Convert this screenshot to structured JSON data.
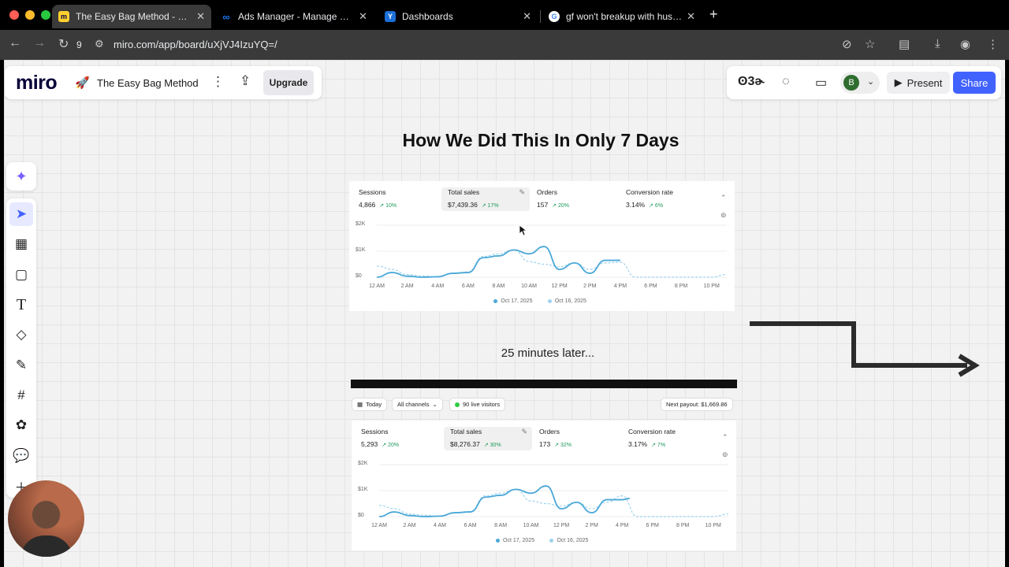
{
  "browser": {
    "tabs": [
      {
        "title": "The Easy Bag Method - Miro",
        "active": true,
        "favicon": "miro-icon"
      },
      {
        "title": "Ads Manager - Manage ads -",
        "active": false,
        "favicon": "meta-icon"
      },
      {
        "title": "Dashboards",
        "active": false,
        "favicon": "dashboards-icon"
      },
      {
        "title": "gf won't breakup with husban",
        "active": false,
        "favicon": "google-icon"
      }
    ],
    "history_count": "9",
    "url": "miro.com/app/board/uXjVJ4IzuYQ=/"
  },
  "miro": {
    "logo": "miro",
    "board_name": "The Easy Bag Method",
    "upgrade_label": "Upgrade",
    "reactions_label": "ʘ3ɚ",
    "avatar_initial": "B",
    "present_label": "Present",
    "share_label": "Share",
    "tools": [
      "select-tool",
      "templates-tool",
      "sticky-note-tool",
      "text-tool",
      "shapes-tool",
      "pen-tool",
      "frame-tool",
      "apps-tool",
      "comment-tool",
      "more-tool"
    ]
  },
  "board": {
    "heading": "How We Did This In Only 7 Days",
    "caption": "25 minutes later...",
    "colors": {
      "series_today": "#4aa8d8",
      "series_prev": "#9fd3ee",
      "positive": "#1d9a5a",
      "accent": "#4262ff"
    }
  },
  "dashboard_before": {
    "metrics": [
      {
        "label": "Sessions",
        "value": "4,866",
        "delta": "↗ 10%"
      },
      {
        "label": "Total sales",
        "value": "$7,439.36",
        "delta": "↗ 17%"
      },
      {
        "label": "Orders",
        "value": "157",
        "delta": "↗ 20%"
      },
      {
        "label": "Conversion rate",
        "value": "3.14%",
        "delta": "↗ 6%"
      }
    ]
  },
  "dashboard_after": {
    "toolbar": {
      "date": "Today",
      "channels": "All channels",
      "live": "90 live visitors",
      "payout": "Next payout: $1,669.86"
    },
    "metrics": [
      {
        "label": "Sessions",
        "value": "5,293",
        "delta": "↗ 20%"
      },
      {
        "label": "Total sales",
        "value": "$8,276.37",
        "delta": "↗ 30%"
      },
      {
        "label": "Orders",
        "value": "173",
        "delta": "↗ 32%"
      },
      {
        "label": "Conversion rate",
        "value": "3.17%",
        "delta": "↗ 7%"
      }
    ]
  },
  "chart_data": [
    {
      "type": "line",
      "y_ticks": [
        "$2K",
        "$1K",
        "$0"
      ],
      "ylim": [
        0,
        2000
      ],
      "x_ticks": [
        "12 AM",
        "2 AM",
        "4 AM",
        "6 AM",
        "8 AM",
        "10 AM",
        "12 PM",
        "2 PM",
        "4 PM",
        "6 PM",
        "8 PM",
        "10 PM"
      ],
      "legend_position": "bottom",
      "series": [
        {
          "name": "Oct 17, 2025",
          "style": "solid",
          "x": [
            0,
            1,
            2,
            3,
            4,
            5,
            6,
            7,
            8,
            9,
            10,
            11,
            12,
            13,
            14,
            15,
            16
          ],
          "y": [
            0,
            180,
            40,
            0,
            20,
            150,
            180,
            750,
            820,
            1050,
            900,
            1180,
            300,
            550,
            150,
            650,
            650
          ]
        },
        {
          "name": "Oct 16, 2025",
          "style": "dashed",
          "x": [
            0,
            1,
            2,
            3,
            4,
            5,
            6,
            7,
            8,
            9,
            10,
            11,
            12,
            13,
            14,
            15,
            16,
            17,
            18,
            19,
            20,
            21,
            22,
            23
          ],
          "y": [
            430,
            300,
            100,
            50,
            0,
            150,
            200,
            800,
            900,
            1050,
            600,
            500,
            400,
            550,
            300,
            550,
            580,
            0,
            0,
            0,
            0,
            0,
            0,
            100
          ]
        }
      ]
    },
    {
      "type": "line",
      "y_ticks": [
        "$2K",
        "$1K",
        "$0"
      ],
      "ylim": [
        0,
        2000
      ],
      "x_ticks": [
        "12 AM",
        "2 AM",
        "4 AM",
        "6 AM",
        "8 AM",
        "10 AM",
        "12 PM",
        "2 PM",
        "4 PM",
        "6 PM",
        "8 PM",
        "10 PM"
      ],
      "legend_position": "bottom",
      "series": [
        {
          "name": "Oct 17, 2025",
          "style": "solid",
          "x": [
            0,
            1,
            2,
            3,
            4,
            5,
            6,
            7,
            8,
            9,
            10,
            11,
            12,
            13,
            14,
            15,
            16,
            16.5
          ],
          "y": [
            0,
            180,
            40,
            0,
            20,
            150,
            180,
            750,
            820,
            1050,
            900,
            1180,
            300,
            550,
            150,
            650,
            650,
            700
          ]
        },
        {
          "name": "Oct 16, 2025",
          "style": "dashed",
          "x": [
            0,
            1,
            2,
            3,
            4,
            5,
            6,
            7,
            8,
            9,
            10,
            11,
            12,
            13,
            14,
            15,
            16,
            17,
            18,
            19,
            20,
            21,
            22,
            23
          ],
          "y": [
            430,
            300,
            100,
            50,
            0,
            150,
            200,
            800,
            900,
            1050,
            600,
            500,
            400,
            550,
            300,
            550,
            800,
            0,
            0,
            0,
            0,
            0,
            0,
            100
          ]
        }
      ]
    }
  ]
}
